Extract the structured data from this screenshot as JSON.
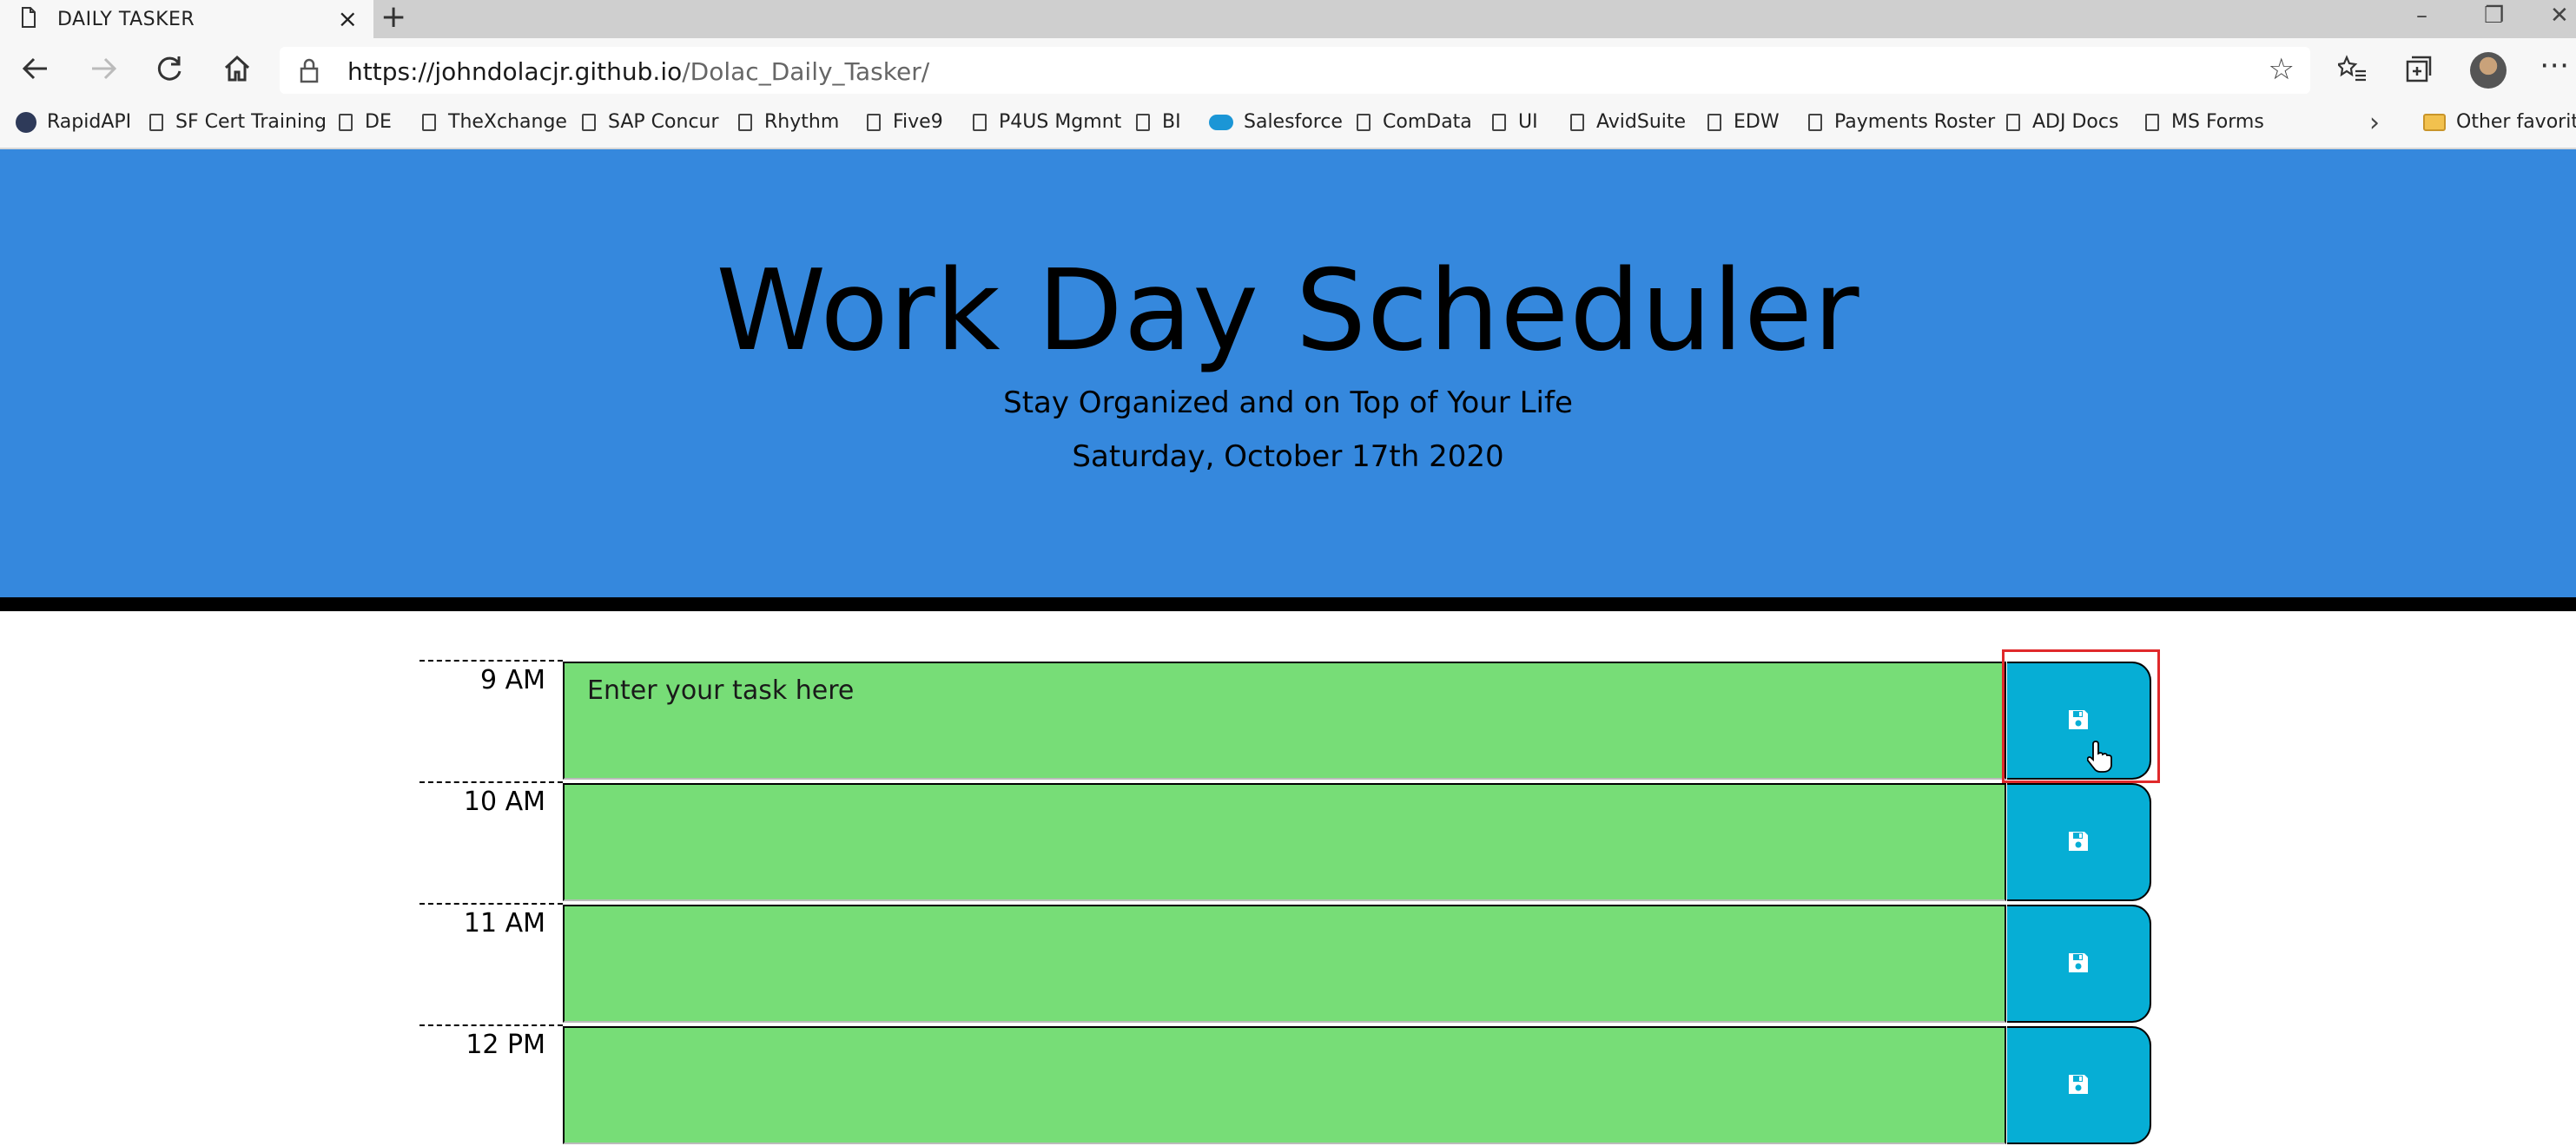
{
  "browser": {
    "tab_title": "DAILY TASKER",
    "url_host": "https://johndolacjr.github.io",
    "url_path": "/Dolac_Daily_Tasker/",
    "bookmarks": [
      {
        "label": "RapidAPI",
        "icon": "rapidapi-icon"
      },
      {
        "label": "SF Cert Training",
        "icon": "page-icon"
      },
      {
        "label": "DE",
        "icon": "page-icon"
      },
      {
        "label": "TheXchange",
        "icon": "page-icon"
      },
      {
        "label": "SAP Concur",
        "icon": "page-icon"
      },
      {
        "label": "Rhythm",
        "icon": "page-icon"
      },
      {
        "label": "Five9",
        "icon": "page-icon"
      },
      {
        "label": "P4US Mgmnt",
        "icon": "page-icon"
      },
      {
        "label": "BI",
        "icon": "page-icon"
      },
      {
        "label": "Salesforce",
        "icon": "salesforce-cloud-icon"
      },
      {
        "label": "ComData",
        "icon": "page-icon"
      },
      {
        "label": "UI",
        "icon": "page-icon"
      },
      {
        "label": "AvidSuite",
        "icon": "page-icon"
      },
      {
        "label": "EDW",
        "icon": "page-icon"
      },
      {
        "label": "Payments Roster",
        "icon": "page-icon"
      },
      {
        "label": "ADJ Docs",
        "icon": "page-icon"
      },
      {
        "label": "MS Forms",
        "icon": "page-icon"
      }
    ],
    "other_favorites": "Other favorites"
  },
  "header": {
    "title": "Work Day Scheduler",
    "subtitle": "Stay Organized and on Top of Your Life",
    "date": "Saturday, October 17th 2020",
    "bg_color": "#3588dd"
  },
  "schedule": {
    "task_placeholder": "Enter your task here",
    "task_color": "#77dd77",
    "save_color": "#06aed5",
    "save_icon": "floppy-disk-icon",
    "rows": [
      {
        "hour": "9 AM",
        "placeholder": "Enter your task here"
      },
      {
        "hour": "10 AM",
        "placeholder": ""
      },
      {
        "hour": "11 AM",
        "placeholder": ""
      },
      {
        "hour": "12 PM",
        "placeholder": ""
      }
    ]
  }
}
